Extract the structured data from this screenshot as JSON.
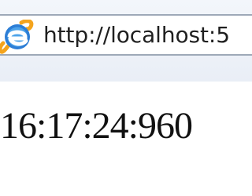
{
  "browser": {
    "address_bar": {
      "url": "http://localhost:5"
    },
    "icon": "internet-explorer-icon",
    "colors": {
      "chrome_background": "#eef3f9",
      "address_border": "#9ea9b8",
      "icon_blue": "#2d7ed6",
      "icon_orange": "#f4a41d",
      "text": "#1f1f1f"
    }
  },
  "page": {
    "time_display": "16:17:24:960"
  }
}
